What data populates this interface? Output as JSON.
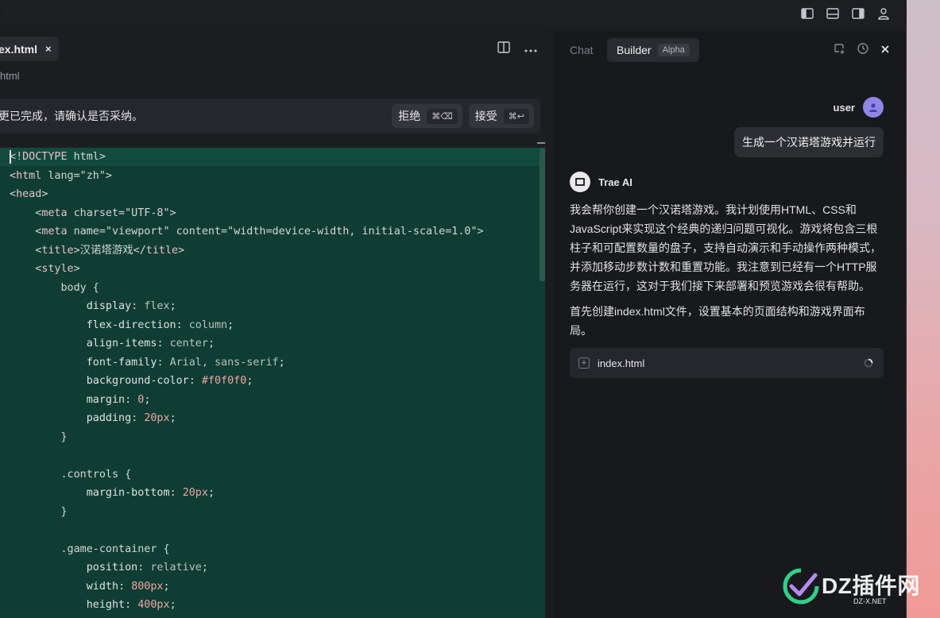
{
  "titlebar": {
    "ghost_text": "…"
  },
  "editor": {
    "tab_label": "ex.html",
    "tab_close": "×",
    "breadcrumb": "html",
    "review": {
      "text": "更已完成，请确认是否采纳。",
      "reject_label": "拒绝",
      "reject_kbd": "⌘⌫",
      "accept_label": "接受",
      "accept_kbd": "⌘↩"
    },
    "code_lines": [
      "<!DOCTYPE html>",
      "<html lang=\"zh\">",
      "<head>",
      "    <meta charset=\"UTF-8\">",
      "    <meta name=\"viewport\" content=\"width=device-width, initial-scale=1.0\">",
      "    <title>汉诺塔游戏</title>",
      "    <style>",
      "        body {",
      "            display: flex;",
      "            flex-direction: column;",
      "            align-items: center;",
      "            font-family: Arial, sans-serif;",
      "            background-color: #f0f0f0;",
      "            margin: 0;",
      "            padding: 20px;",
      "        }",
      "",
      "        .controls {",
      "            margin-bottom: 20px;",
      "        }",
      "",
      "        .game-container {",
      "            position: relative;",
      "            width: 800px;",
      "            height: 400px;"
    ]
  },
  "panel": {
    "tab_chat": "Chat",
    "tab_builder": "Builder",
    "builder_badge": "Alpha",
    "user_name": "user",
    "user_message": "生成一个汉诺塔游戏并运行",
    "ai_name": "Trae AI",
    "ai_paragraphs": [
      "我会帮你创建一个汉诺塔游戏。我计划使用HTML、CSS和JavaScript来实现这个经典的递归问题可视化。游戏将包含三根柱子和可配置数量的盘子，支持自动演示和手动操作两种模式，并添加移动步数计数和重置功能。我注意到已经有一个HTTP服务器在运行，这对于我们接下来部署和预览游戏会很有帮助。",
      "首先创建index.html文件，设置基本的页面结构和游戏界面布局。"
    ],
    "file_chip": "index.html"
  },
  "watermark": {
    "text": "DZ插件网",
    "sub": "DZ-X.NET"
  },
  "colors": {
    "code_bg": "#0f3d33",
    "avatar": "#8f86e8",
    "accent_green": "#2fd08a"
  }
}
